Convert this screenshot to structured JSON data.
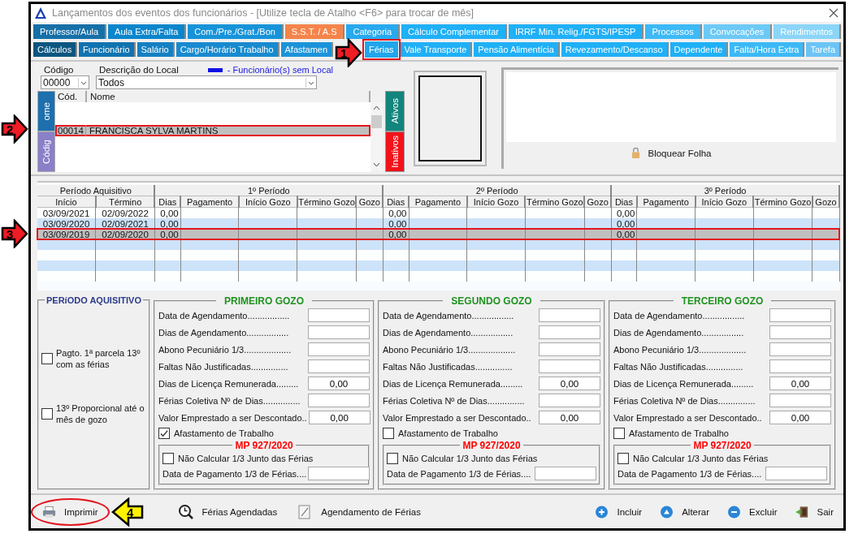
{
  "window": {
    "title": "Lançamentos dos eventos dos funcionários - [Utilize tecla de Atalho <F6> para trocar de mês]"
  },
  "tab_rows": [
    [
      {
        "label": "Professor/Aula",
        "color": "#1670a8",
        "selected": false,
        "highlighted": false
      },
      {
        "label": "Aula Extra/Falta",
        "color": "#0b86cc",
        "selected": false,
        "highlighted": false
      },
      {
        "label": "Com./Pre./Grat./Bon",
        "color": "#1793d9",
        "selected": false,
        "highlighted": false
      },
      {
        "label": "S.S.T. / A.S",
        "color": "#f5844a",
        "selected": false,
        "highlighted": false
      },
      {
        "label": "Categoria",
        "color": "#27a9ef",
        "selected": false,
        "highlighted": false
      },
      {
        "label": "Cálculo Complementar",
        "color": "#1fb0f6",
        "selected": false,
        "highlighted": false
      },
      {
        "label": "IRRF Min. Relig./FGTS/IPESP",
        "color": "#1fb0f6",
        "selected": false,
        "highlighted": false
      },
      {
        "label": "Processos",
        "color": "#3cb9f6",
        "selected": false,
        "highlighted": false
      },
      {
        "label": "Convocações",
        "color": "#6cc9f6",
        "selected": false,
        "highlighted": false
      },
      {
        "label": "Rendimentos",
        "color": "#8ad5f8",
        "selected": false,
        "highlighted": false
      }
    ],
    [
      {
        "label": "Cálculos",
        "color": "#0c5680",
        "selected": false,
        "highlighted": false
      },
      {
        "label": "Funcionário",
        "color": "#1173b0",
        "selected": false,
        "highlighted": false
      },
      {
        "label": "Salário",
        "color": "#1580c2",
        "selected": false,
        "highlighted": false
      },
      {
        "label": "Cargo/Horário Trabalho",
        "color": "#188acf",
        "selected": false,
        "highlighted": false
      },
      {
        "label": "Afastamen",
        "color": "#1b93d9",
        "selected": false,
        "highlighted": false
      },
      {
        "label": "Férias",
        "color": "#20a6ec",
        "selected": true,
        "highlighted": true,
        "annotation": {
          "number": "1",
          "color": "#ee1c25",
          "kind": "right"
        }
      },
      {
        "label": "Vale Transporte",
        "color": "#1fb0f6",
        "selected": false,
        "highlighted": false
      },
      {
        "label": "Pensão Alimentícia",
        "color": "#1fb0f6",
        "selected": false,
        "highlighted": false
      },
      {
        "label": "Revezamento/Descanso",
        "color": "#1fb0f6",
        "selected": false,
        "highlighted": false
      },
      {
        "label": "Dependente",
        "color": "#1fb0f6",
        "selected": false,
        "highlighted": false
      },
      {
        "label": "Falta/Hora Extra",
        "color": "#3cb9f6",
        "selected": false,
        "highlighted": false
      },
      {
        "label": "Tarefa",
        "color": "#6cc4f4",
        "selected": false,
        "highlighted": false
      }
    ]
  ],
  "filter": {
    "code_label": "Código",
    "code_value": "00000",
    "local_label": "Descrição do Local",
    "local_value": "Todos",
    "legend": "- Funcionário(s) sem Local"
  },
  "list_side_tabs": [
    {
      "label": "ome",
      "color": "#1d6fae"
    },
    {
      "label": "Códig",
      "color": "#8a80c8"
    }
  ],
  "list_columns": [
    "Cód.",
    "Nome"
  ],
  "employees": [
    {
      "code": "00014",
      "name": "FRANCISCA SYLVA MARTINS",
      "selected": true,
      "highlighted": true,
      "annotation": {
        "number": "2",
        "color": "#ee1c25",
        "kind": "right"
      }
    }
  ],
  "status_tabs": [
    {
      "label": "Ativos",
      "color": "#12857c"
    },
    {
      "label": "Inativos",
      "color": "#f2121a"
    }
  ],
  "lock_label": "Bloquear Folha",
  "grid": {
    "group_headers": [
      "Período Aquisitivo",
      "1º Período",
      "2º Período",
      "3º Período"
    ],
    "columns": [
      "Início",
      "Término",
      "Dias",
      "Pagamento",
      "Início Gozo",
      "Término Gozo",
      "Gozo",
      "Dias",
      "Pagamento",
      "Início Gozo",
      "Término Gozo",
      "Gozo",
      "Dias",
      "Pagamento",
      "Início Gozo",
      "Término Gozo",
      "Gozo"
    ],
    "rows": [
      {
        "start": "03/09/2021",
        "end": "02/09/2022",
        "days": [
          "0,00",
          "0,00",
          "0,00"
        ],
        "selected": false,
        "highlighted": false
      },
      {
        "start": "03/09/2020",
        "end": "02/09/2021",
        "days": [
          "0,00",
          "0,00",
          "0,00"
        ],
        "selected": false,
        "highlighted": false
      },
      {
        "start": "03/09/2019",
        "end": "02/09/2020",
        "days": [
          "0,00",
          "0,00",
          "0,00"
        ],
        "selected": true,
        "highlighted": true,
        "annotation": {
          "number": "3",
          "color": "#ee1c25",
          "kind": "right"
        }
      }
    ]
  },
  "acquisition": {
    "title": "PERíODO AQUISITIVO",
    "options": [
      {
        "label": "Pagto. 1ª parcela 13º com as férias",
        "checked": false
      },
      {
        "label": "13º Proporcional até o mês de gozo",
        "checked": false
      }
    ]
  },
  "gozos": [
    {
      "title": "PRIMEIRO GOZO",
      "fields": [
        {
          "label": "Data de Agendamento................."
        },
        {
          "label": "Dias de Agendamento................."
        },
        {
          "label": "Abono Pecuniário 1/3..................."
        },
        {
          "label": "Faltas Não Justificadas..............."
        },
        {
          "label": "Dias de Licença Remunerada.........",
          "value": "0,00"
        },
        {
          "label": "Férias Coletiva Nº de Dias..............."
        },
        {
          "label": "Valor Emprestado a ser Descontado..",
          "value": "0,00"
        }
      ],
      "leave": {
        "label": "Afastamento de Trabalho",
        "checked": true
      },
      "mp": {
        "title": "MP 927/2020",
        "option": {
          "label": "Não Calcular 1/3 Junto das Férias",
          "checked": false
        },
        "field_label": "Data de Pagamento 1/3 de Férias...."
      }
    },
    {
      "title": "SEGUNDO GOZO",
      "fields": [
        {
          "label": "Data de Agendamento................."
        },
        {
          "label": "Dias de Agendamento................."
        },
        {
          "label": "Abono Pecuniário 1/3..................."
        },
        {
          "label": "Faltas Não Justificadas..............."
        },
        {
          "label": "Dias de Licença Remunerada.........",
          "value": "0,00"
        },
        {
          "label": "Férias Coletiva Nº de Dias..............."
        },
        {
          "label": "Valor Emprestado a ser Descontado..",
          "value": "0,00"
        }
      ],
      "leave": {
        "label": "Afastamento de Trabalho",
        "checked": false
      },
      "mp": {
        "title": "MP 927/2020",
        "option": {
          "label": "Não Calcular 1/3 Junto das Férias",
          "checked": false
        },
        "field_label": "Data de Pagamento 1/3 de Férias...."
      }
    },
    {
      "title": "TERCEIRO GOZO",
      "fields": [
        {
          "label": "Data de Agendamento................."
        },
        {
          "label": "Dias de Agendamento................."
        },
        {
          "label": "Abono Pecuniário 1/3..................."
        },
        {
          "label": "Faltas Não Justificadas..............."
        },
        {
          "label": "Dias de Licença Remunerada.........",
          "value": "0,00"
        },
        {
          "label": "Férias Coletiva Nº de Dias..............."
        },
        {
          "label": "Valor Emprestado a ser Descontado..",
          "value": "0,00"
        }
      ],
      "leave": {
        "label": "Afastamento de Trabalho",
        "checked": false
      },
      "mp": {
        "title": "MP 927/2020",
        "option": {
          "label": "Não Calcular 1/3 Junto das Férias",
          "checked": false
        },
        "field_label": "Data de Pagamento 1/3 de Férias...."
      }
    }
  ],
  "footer_left": [
    {
      "label": "Imprimir",
      "kind": "printer",
      "highlighted": true,
      "annotation": {
        "number": "4",
        "color": "#fff200",
        "kind": "left"
      }
    },
    {
      "label": "Férias Agendadas",
      "kind": "clock",
      "highlighted": false
    },
    {
      "label": "Agendamento de Férias",
      "kind": "note",
      "highlighted": false
    }
  ],
  "footer_right": [
    {
      "label": "Incluir",
      "kind": "plus"
    },
    {
      "label": "Alterar",
      "kind": "up"
    },
    {
      "label": "Excluir",
      "kind": "minus"
    },
    {
      "label": "Sair",
      "kind": "exit"
    }
  ]
}
